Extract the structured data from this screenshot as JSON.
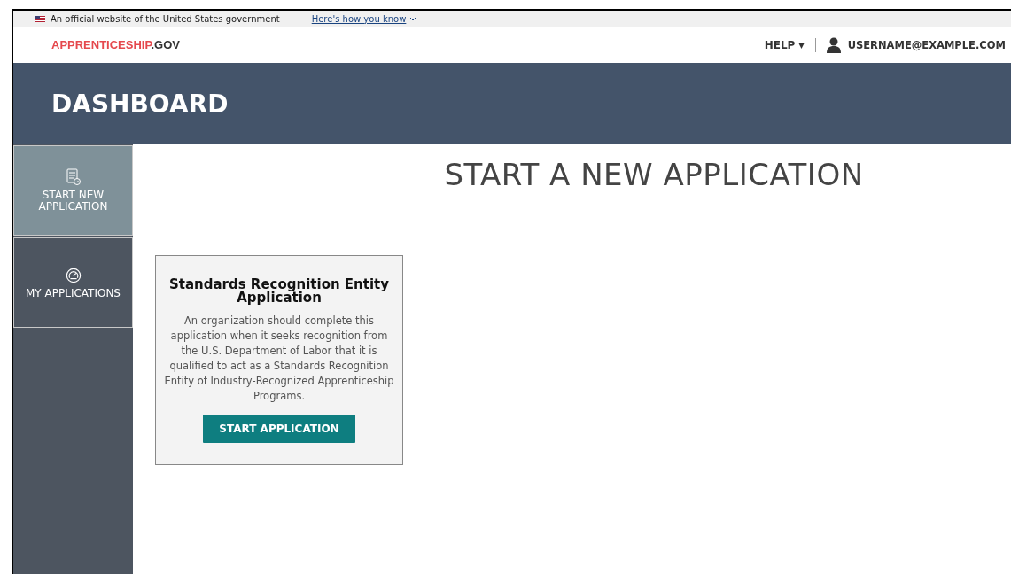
{
  "gov_banner": {
    "text": "An official website of the United States government",
    "link": "Here's how you know"
  },
  "header": {
    "logo": {
      "brand": "APPRENTICESHIP",
      "suffix": ".GOV"
    },
    "help": "HELP ▾",
    "user": "USERNAME@EXAMPLE.COM"
  },
  "page_title": "DASHBOARD",
  "sidebar": {
    "items": [
      {
        "label": "START NEW APPLICATION",
        "kind": "checklist",
        "selected": true
      },
      {
        "label": "MY APPLICATIONS",
        "kind": "gauge",
        "selected": false
      }
    ]
  },
  "main": {
    "heading": "START A NEW APPLICATION",
    "cards": [
      {
        "title": "Standards Recognition Entity Application",
        "description": "An organization should complete this application when it seeks recognition from the U.S. Department of Labor that it is qualified to act as a Standards Recognition Entity of Industry-Recognized Apprenticeship Programs.",
        "button": "START APPLICATION"
      }
    ]
  }
}
